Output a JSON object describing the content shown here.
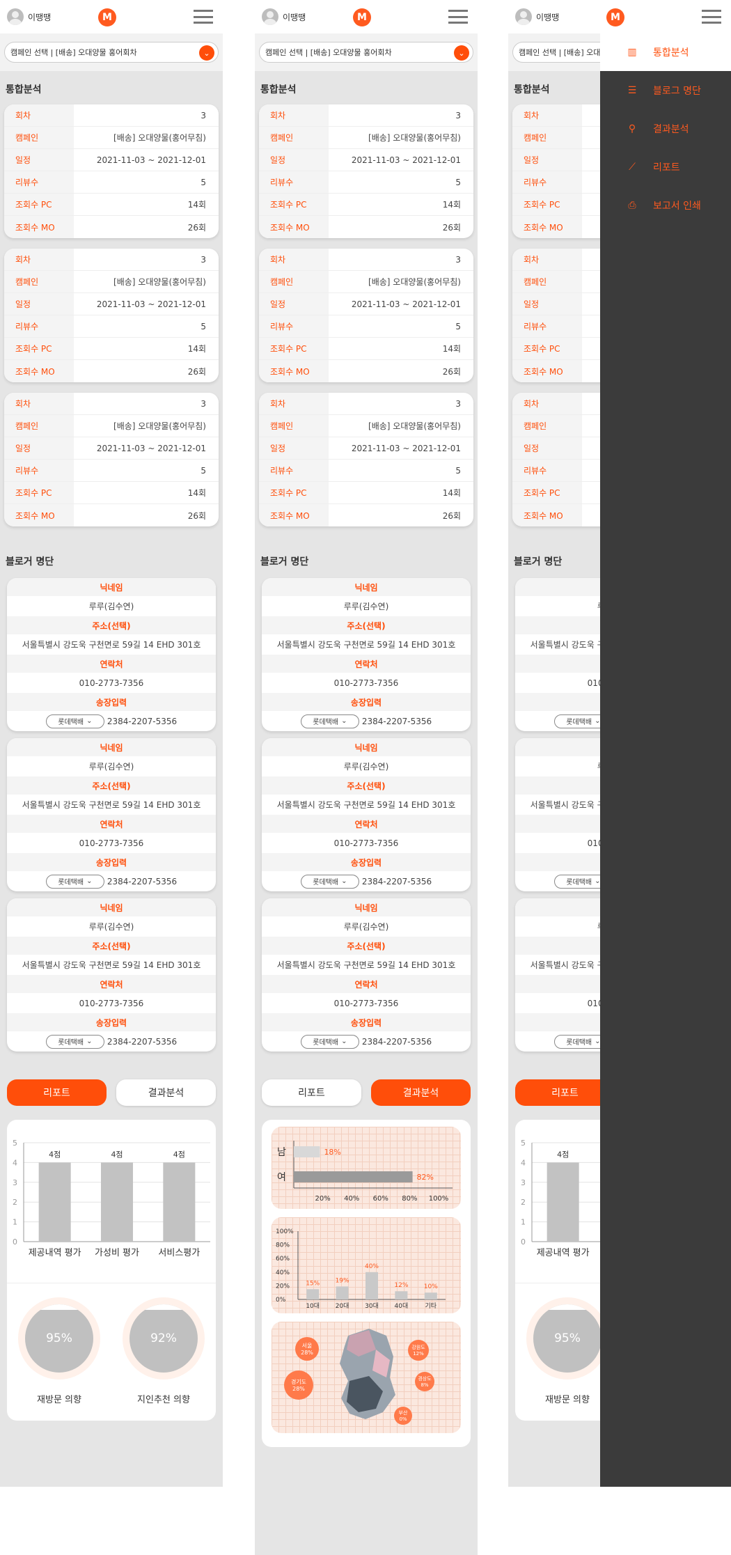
{
  "user": {
    "name": "이땡땡"
  },
  "logo": "M",
  "campaign_select": "캠페인 선택 | [배송] 오대양물 홍어회차",
  "sections": {
    "analysis": "통합분석",
    "blogger": "블로거 명단"
  },
  "analysis_rows": [
    {
      "label": "회차",
      "value": "3"
    },
    {
      "label": "캠페인",
      "value": "[배송] 오대양물(홍어무침)"
    },
    {
      "label": "일정",
      "value": "2021-11-03 ~ 2021-12-01"
    },
    {
      "label": "리뷰수",
      "value": "5"
    },
    {
      "label": "조회수 PC",
      "value": "14회"
    },
    {
      "label": "조회수 MO",
      "value": "26회"
    }
  ],
  "blogger": {
    "nick_label": "닉네임",
    "nick": "루루(김수연)",
    "addr_label": "주소(선택)",
    "addr": "서울특별시 강도욱 구천면로 59길 14 EHD 301호",
    "phone_label": "연락처",
    "phone": "010-2773-7356",
    "ship_label": "송장입력",
    "courier": "롯데택배",
    "invoice": "2384-2207-5356"
  },
  "tabs": {
    "report": "리포트",
    "result": "결과분석"
  },
  "chart_data": [
    {
      "type": "bar",
      "categories": [
        "제공내역 평가",
        "가성비 평가",
        "서비스평가"
      ],
      "values": [
        4,
        4,
        4
      ],
      "data_labels": [
        "4점",
        "4점",
        "4점"
      ],
      "yticks": [
        "0",
        "1",
        "2",
        "3",
        "4",
        "5"
      ],
      "ylim": [
        0,
        5
      ]
    },
    {
      "type": "bar",
      "orientation": "horizontal",
      "categories": [
        "남",
        "여"
      ],
      "values": [
        18,
        82
      ],
      "data_labels": [
        "18%",
        "82%"
      ],
      "xticks": [
        "20%",
        "40%",
        "60%",
        "80%",
        "100%"
      ]
    },
    {
      "type": "bar",
      "categories": [
        "10대",
        "20대",
        "30대",
        "40대",
        "기타"
      ],
      "values": [
        15,
        19,
        40,
        12,
        10
      ],
      "data_labels": [
        "15%",
        "19%",
        "40%",
        "12%",
        "10%"
      ],
      "yticks": [
        "0%",
        "20%",
        "40%",
        "60%",
        "80%",
        "100%"
      ]
    }
  ],
  "gauges": [
    {
      "value": "95%",
      "label": "재방문 의향"
    },
    {
      "value": "92%",
      "label": "지인추천 의향"
    }
  ],
  "regions": [
    {
      "name": "서울",
      "value": "28%"
    },
    {
      "name": "경기도",
      "value": "28%"
    },
    {
      "name": "강원도",
      "value": "12%"
    },
    {
      "name": "경상도",
      "value": "8%"
    },
    {
      "name": "부산",
      "value": "0%"
    }
  ],
  "drawer": [
    {
      "icon": "chart-icon",
      "label": "통합분석"
    },
    {
      "icon": "list-icon",
      "label": "블로그 명단"
    },
    {
      "icon": "search-analysis-icon",
      "label": "결과분석"
    },
    {
      "icon": "line-chart-icon",
      "label": "리포트"
    },
    {
      "icon": "printer-icon",
      "label": "보고서 인쇄"
    }
  ],
  "colors": {
    "accent": "#ff4e0a",
    "drawer_bg": "#3b3b3b"
  }
}
